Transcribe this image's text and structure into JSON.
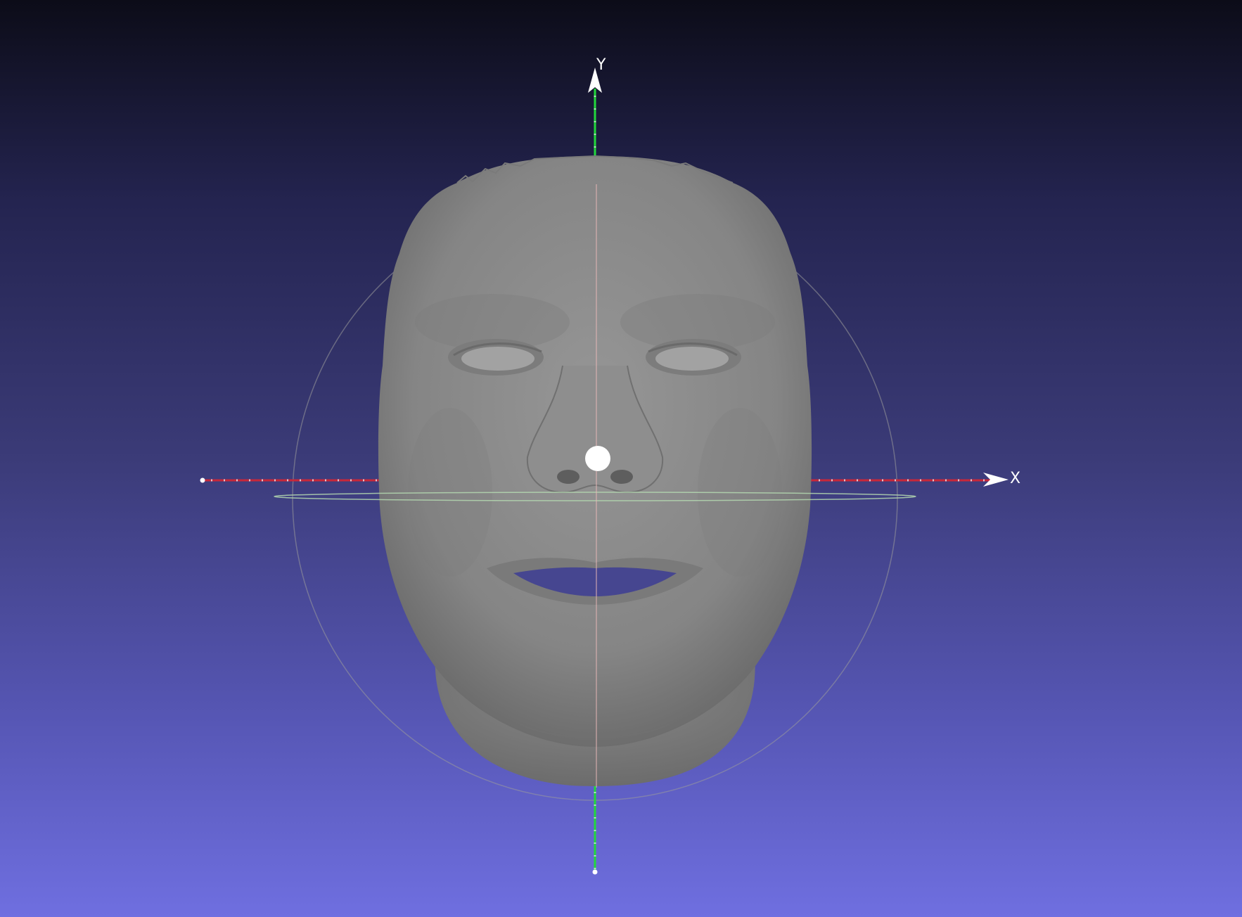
{
  "viewer": {
    "background_top_color": "#0c0c18",
    "background_bottom_color": "#6f6fe0",
    "mesh_color": "#868686",
    "x_axis_color": "#c8283a",
    "y_axis_color": "#22d83c",
    "trackball_ring_color": "#9a9a9a",
    "horizontal_ring_color": "#b4d8b0",
    "pivot_icon": "pivot-point-icon"
  },
  "axes": {
    "x_label": "X",
    "y_label": "Y"
  }
}
